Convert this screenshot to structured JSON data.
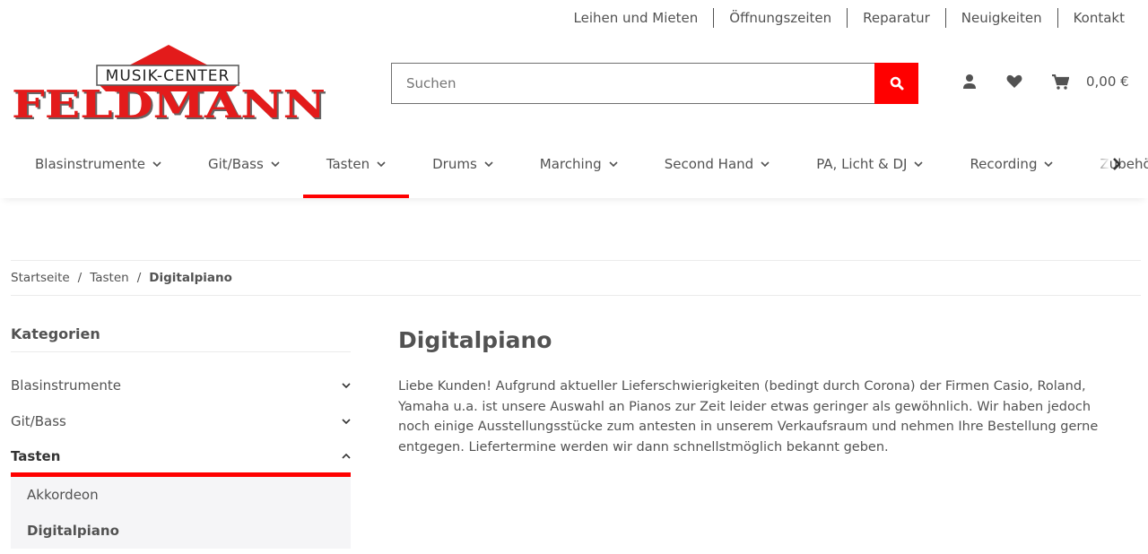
{
  "top_links": [
    "Leihen und Mieten",
    "Öffnungszeiten",
    "Reparatur",
    "Neuigkeiten",
    "Kontakt"
  ],
  "logo": {
    "top": "MUSIK-CENTER",
    "main": "FELDMANN"
  },
  "search": {
    "placeholder": "Suchen"
  },
  "cart": {
    "total": "0,00 €"
  },
  "nav": [
    "Blasinstrumente",
    "Git/Bass",
    "Tasten",
    "Drums",
    "Marching",
    "Second Hand",
    "PA, Licht & DJ",
    "Recording",
    "Zubehör"
  ],
  "breadcrumb": [
    "Startseite",
    "Tasten",
    "Digitalpiano"
  ],
  "sidebar": {
    "title": "Kategorien",
    "items": [
      "Blasinstrumente",
      "Git/Bass",
      "Tasten"
    ],
    "sub": [
      "Akkordeon",
      "Digitalpiano"
    ]
  },
  "main": {
    "title": "Digitalpiano",
    "text": "Liebe Kunden! Aufgrund aktueller Lieferschwierigkeiten (bedingt durch Corona) der Firmen Casio, Roland, Yamaha u.a. ist unsere Auswahl an Pianos zur Zeit leider etwas geringer als gewöhnlich. Wir haben jedoch noch einige Ausstellungsstücke zum antesten in unserem Verkaufsraum und nehmen Ihre Bestellung gerne entgegen. Liefertermine werden wir dann schnellstmöglich bekannt geben."
  },
  "colors": {
    "accent": "#ff0000",
    "text": "#525252"
  }
}
